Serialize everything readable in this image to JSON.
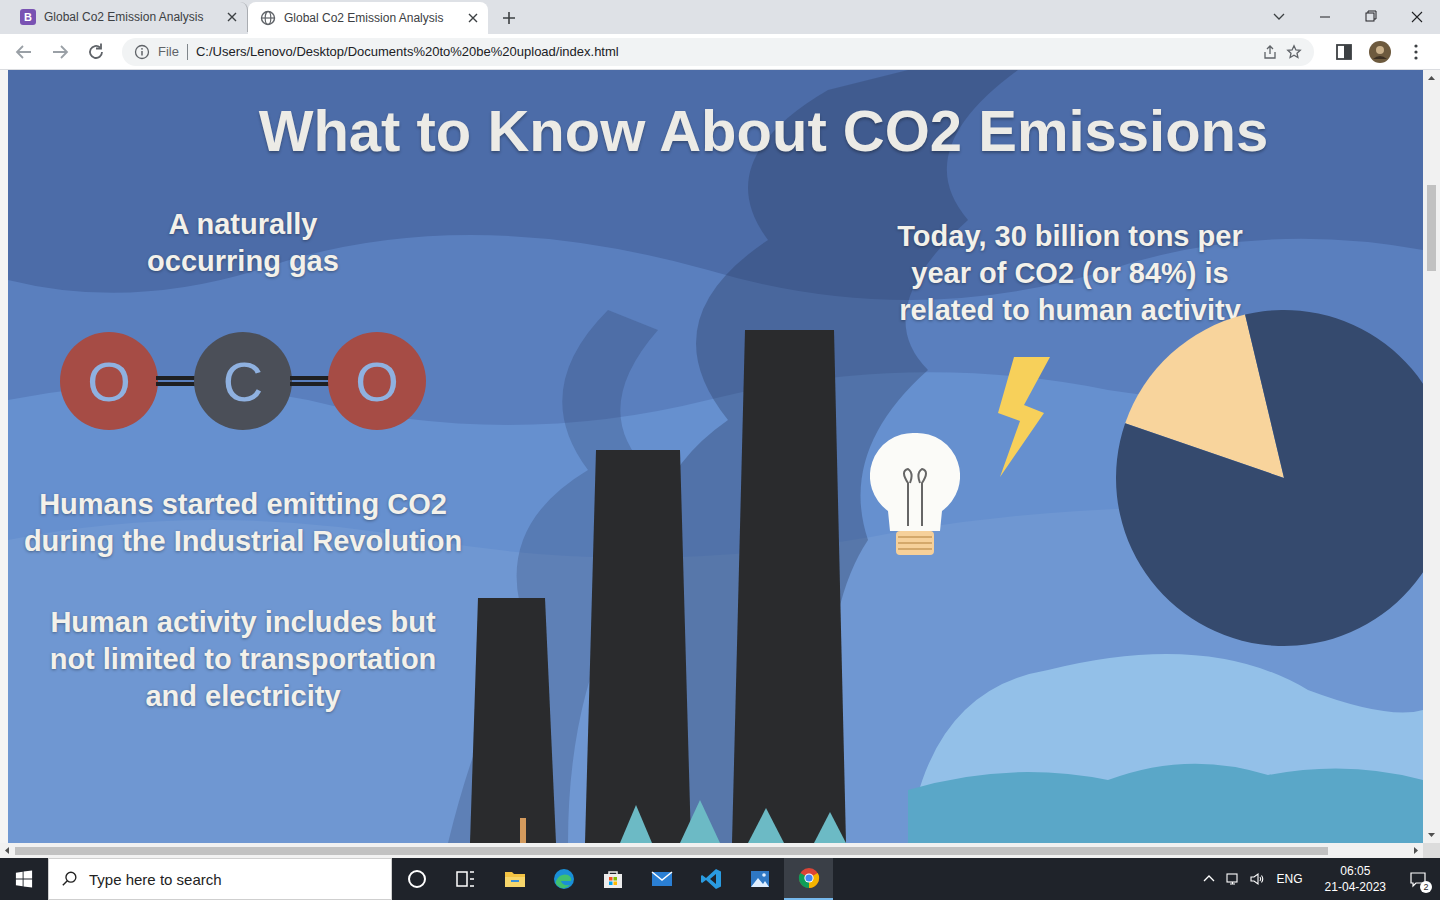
{
  "browser": {
    "tabs": [
      {
        "label": "Global Co2 Emission Analysis",
        "favicon": "B",
        "selected": false
      },
      {
        "label": "Global Co2 Emission Analysis",
        "favicon": "",
        "selected": true
      }
    ],
    "address": {
      "scheme": "File",
      "url": "C:/Users/Lenovo/Desktop/Documents%20to%20be%20upload/index.html"
    }
  },
  "infographic": {
    "title": "What to Know About CO2 Emissions",
    "left_texts": [
      "A naturally occurring gas",
      "Humans started emitting CO2 during the Industrial Revolution",
      "Human activity includes but not limited to transportation and electricity"
    ],
    "molecule": [
      {
        "symbol": "O",
        "color": "#a64c45"
      },
      {
        "symbol": "C",
        "color": "#4b4f58"
      },
      {
        "symbol": "O",
        "color": "#a64c45"
      }
    ],
    "right_text": "Today, 30 billion tons per year of CO2 (or 84%) is related to human activity",
    "pie": {
      "slices": [
        {
          "value": 16,
          "color": "#f8d49c"
        },
        {
          "value": 84,
          "color": "#354a6e"
        }
      ]
    }
  },
  "taskbar": {
    "search_placeholder": "Type here to search",
    "apps": [
      {
        "kind": "cortana",
        "active": false
      },
      {
        "kind": "taskview",
        "active": false
      },
      {
        "kind": "explorer",
        "active": false
      },
      {
        "kind": "edge",
        "active": false
      },
      {
        "kind": "store",
        "active": false
      },
      {
        "kind": "mail",
        "active": false
      },
      {
        "kind": "vscode",
        "active": false
      },
      {
        "kind": "photos",
        "active": false
      },
      {
        "kind": "chrome",
        "active": true
      }
    ],
    "tray": {
      "language": "ENG",
      "time": "06:05",
      "date": "21-04-2023",
      "notifications": "2"
    }
  }
}
